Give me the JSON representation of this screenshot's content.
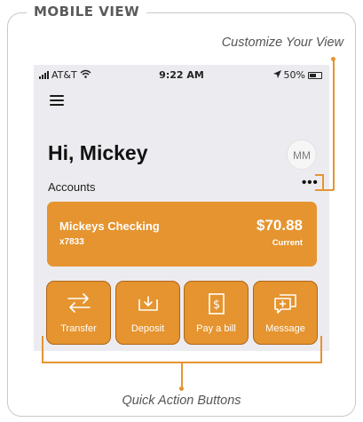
{
  "header": {
    "title": "MOBILE VIEW"
  },
  "annotations": {
    "customize": "Customize Your View",
    "quick_actions": "Quick Action Buttons"
  },
  "status_bar": {
    "carrier": "AT&T",
    "time": "9:22 AM",
    "battery": "50%",
    "icons": [
      "signal-icon",
      "wifi-icon",
      "location-arrow-icon",
      "battery-icon"
    ]
  },
  "app": {
    "greeting": "Hi, Mickey",
    "avatar_initials": "MM",
    "accounts_label": "Accounts",
    "more_label": "•••",
    "account": {
      "name": "Mickeys Checking",
      "number": "x7833",
      "balance": "$70.88",
      "status": "Current"
    },
    "actions": [
      {
        "label": "Transfer",
        "icon": "transfer-arrows-icon"
      },
      {
        "label": "Deposit",
        "icon": "deposit-icon"
      },
      {
        "label": "Pay a bill",
        "icon": "bill-dollar-icon"
      },
      {
        "label": "Message",
        "icon": "message-icon"
      }
    ]
  },
  "colors": {
    "accent": "#e5942f",
    "accent_border": "#b0651a",
    "phone_background": "#ececf0",
    "frame_border": "#c9c9c9"
  }
}
